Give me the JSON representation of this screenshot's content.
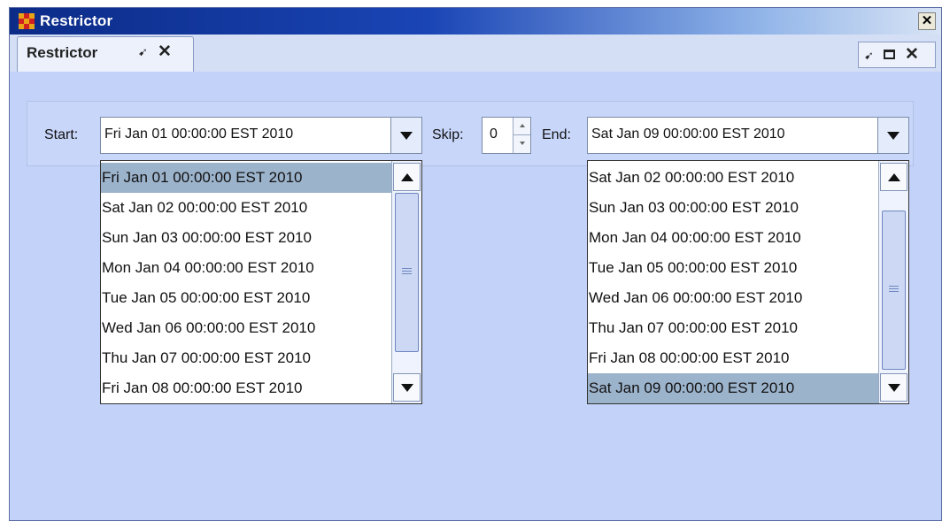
{
  "window": {
    "title": "Restrictor",
    "close_glyph": "✕"
  },
  "tab": {
    "label": "Restrictor",
    "pin_glyph": "➹",
    "close_glyph": "✕"
  },
  "panel_controls": {
    "pin_glyph": "➹",
    "close_glyph": "✕"
  },
  "start": {
    "label": "Start:",
    "value": "Fri Jan 01 00:00:00 EST 2010",
    "options": [
      "Fri Jan 01 00:00:00 EST 2010",
      "Sat Jan 02 00:00:00 EST 2010",
      "Sun Jan 03 00:00:00 EST 2010",
      "Mon Jan 04 00:00:00 EST 2010",
      "Tue Jan 05 00:00:00 EST 2010",
      "Wed Jan 06 00:00:00 EST 2010",
      "Thu Jan 07 00:00:00 EST 2010",
      "Fri Jan 08 00:00:00 EST 2010"
    ],
    "selected_index": 0
  },
  "skip": {
    "label": "Skip:",
    "value": "0"
  },
  "end": {
    "label": "End:",
    "value": "Sat Jan 09 00:00:00 EST 2010",
    "options": [
      "Sat Jan 02 00:00:00 EST 2010",
      "Sun Jan 03 00:00:00 EST 2010",
      "Mon Jan 04 00:00:00 EST 2010",
      "Tue Jan 05 00:00:00 EST 2010",
      "Wed Jan 06 00:00:00 EST 2010",
      "Thu Jan 07 00:00:00 EST 2010",
      "Fri Jan 08 00:00:00 EST 2010",
      "Sat Jan 09 00:00:00 EST 2010"
    ],
    "selected_index": 7
  },
  "colors": {
    "title_bar": "#0b2b87",
    "panel_bg": "#c2d2f9",
    "selection": "#9cb3cc",
    "app_icon_a": "#e8a317",
    "app_icon_b": "#d02020"
  }
}
